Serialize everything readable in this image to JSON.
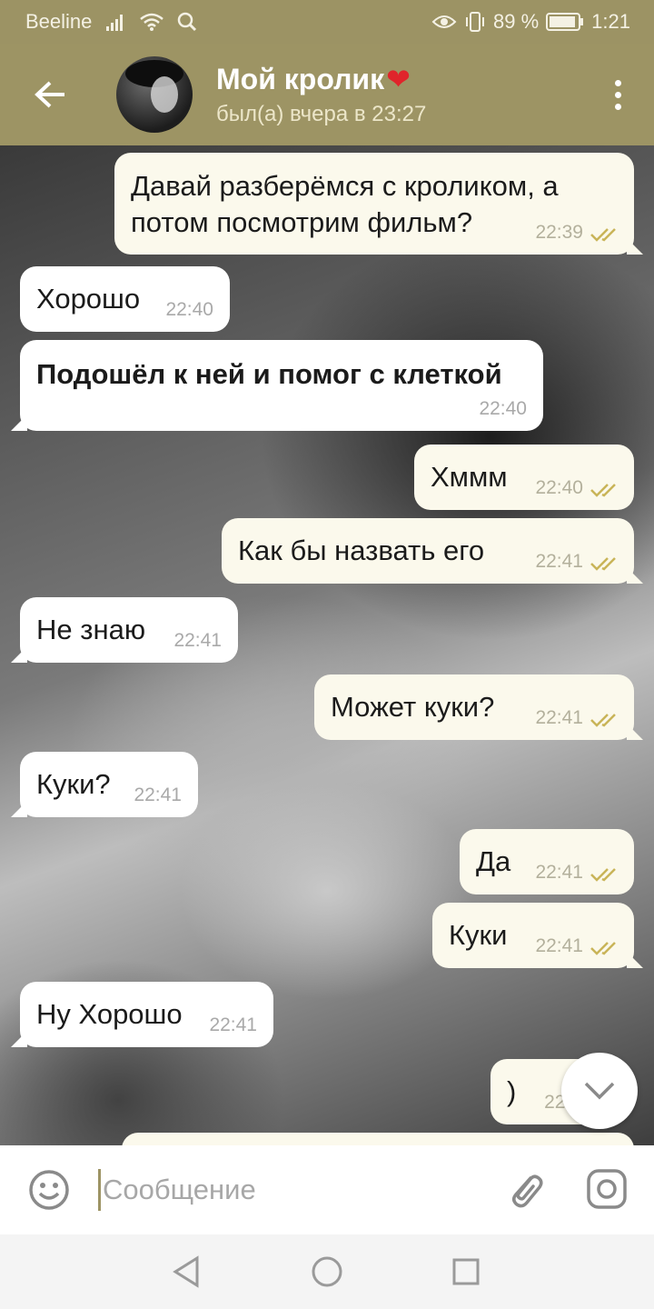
{
  "status_bar": {
    "carrier": "Beeline",
    "battery": "89 %",
    "time": "1:21"
  },
  "header": {
    "title": "Мой кролик",
    "title_emoji": "❤",
    "subtitle": "был(а) вчера в 23:27"
  },
  "messages": [
    {
      "dir": "out",
      "text": "Давай разберёмся с кроликом, а потом посмотрим фильм?",
      "line1": "Давай разберёмся с кроликом, а",
      "line2": "потом посмотрим фильм?",
      "time": "22:39"
    },
    {
      "dir": "in",
      "text": "Хорошо",
      "time": "22:40"
    },
    {
      "dir": "in",
      "text": "Подошёл к ней и помог с клеткой",
      "time": "22:40"
    },
    {
      "dir": "out",
      "text": "Хммм",
      "time": "22:40"
    },
    {
      "dir": "out",
      "text": "Как бы назвать его",
      "time": "22:41"
    },
    {
      "dir": "in",
      "text": "Не знаю",
      "time": "22:41"
    },
    {
      "dir": "out",
      "text": "Может куки?",
      "time": "22:41"
    },
    {
      "dir": "in",
      "text": "Куки?",
      "time": "22:41"
    },
    {
      "dir": "out",
      "text": "Да",
      "time": "22:41"
    },
    {
      "dir": "out",
      "text": "Куки",
      "time": "22:41"
    },
    {
      "dir": "in",
      "text": "Ну Хорошо",
      "time": "22:41"
    },
    {
      "dir": "out",
      "text": ")",
      "time": "22:4"
    }
  ],
  "input": {
    "placeholder": "Сообщение"
  },
  "colors": {
    "header": "#9d9464",
    "outgoing_bubble": "#fbf9ec",
    "incoming_bubble": "#ffffff",
    "read_check": "#c9b458"
  },
  "icons": [
    "back-arrow-icon",
    "more-vert-icon",
    "emoji-icon",
    "attach-icon",
    "camera-icon",
    "chevron-down-icon",
    "nav-back-icon",
    "nav-home-icon",
    "nav-recents-icon"
  ]
}
